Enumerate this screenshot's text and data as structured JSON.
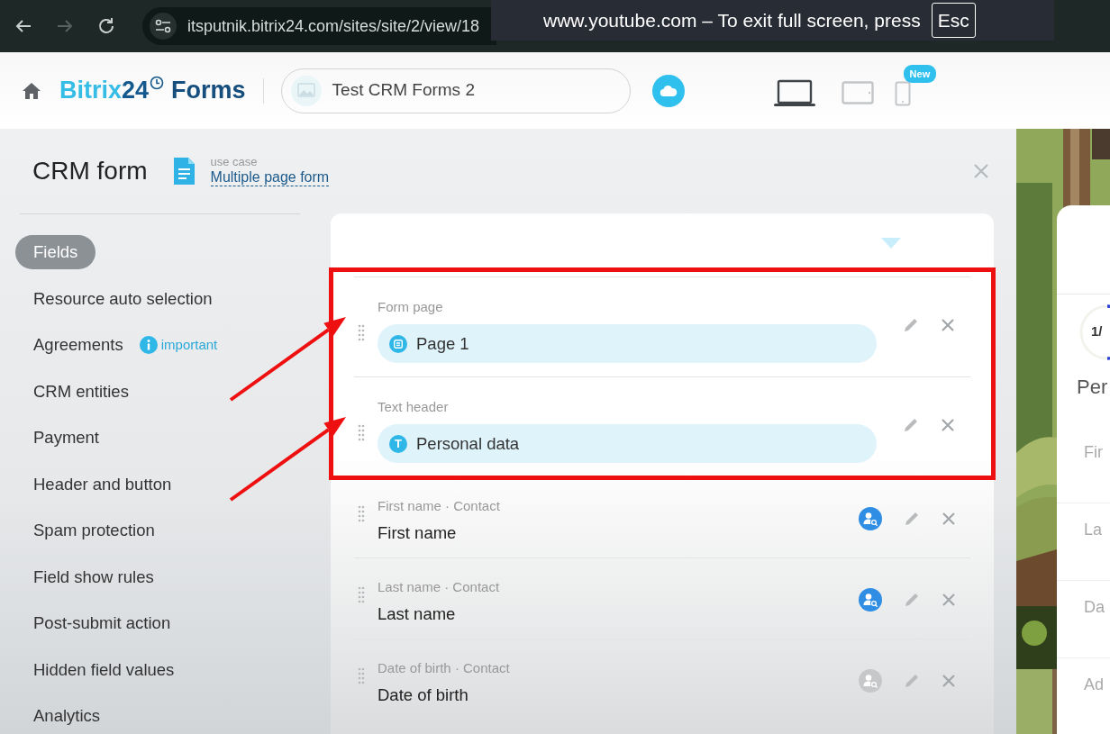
{
  "browser": {
    "nav": [
      {
        "kind": "back",
        "disabled": false
      },
      {
        "kind": "forward",
        "disabled": true
      },
      {
        "kind": "reload",
        "disabled": false
      }
    ],
    "url": "itsputnik.bitrix24.com/sites/site/2/view/18"
  },
  "fullscreen_notice": {
    "text": "www.youtube.com – To exit full screen, press",
    "key": "Esc"
  },
  "header": {
    "logo": {
      "brand": "Bitrix",
      "number": "24",
      "product": "Forms"
    },
    "site_name": "Test CRM Forms 2",
    "devices": [
      {
        "kind": "laptop",
        "selected": true
      },
      {
        "kind": "tablet",
        "selected": false
      },
      {
        "kind": "phone",
        "selected": false,
        "badge": "New"
      }
    ]
  },
  "panel": {
    "title": "CRM form",
    "use_case_label": "use case",
    "use_case": "Multiple page form"
  },
  "menu": [
    {
      "label": "Fields",
      "selected": true
    },
    {
      "label": "Resource auto selection",
      "selected": false
    },
    {
      "label": "Agreements",
      "selected": false,
      "note": "important"
    },
    {
      "label": "CRM entities",
      "selected": false
    },
    {
      "label": "Payment",
      "selected": false
    },
    {
      "label": "Header and button",
      "selected": false
    },
    {
      "label": "Spam protection",
      "selected": false
    },
    {
      "label": "Field show rules",
      "selected": false
    },
    {
      "label": "Post-submit action",
      "selected": false
    },
    {
      "label": "Hidden field values",
      "selected": false
    },
    {
      "label": "Analytics",
      "selected": false
    }
  ],
  "fields": [
    {
      "kind": "page",
      "caption": "Form page",
      "value": "Page 1",
      "highlighted": true
    },
    {
      "kind": "header",
      "caption": "Text header",
      "value": "Personal data",
      "icon_text": "T",
      "highlighted": true
    },
    {
      "kind": "field",
      "caption": "First name · Contact",
      "value": "First name",
      "crm_active": true,
      "highlighted": false
    },
    {
      "kind": "field",
      "caption": "Last name · Contact",
      "value": "Last name",
      "crm_active": true,
      "highlighted": false
    },
    {
      "kind": "field",
      "caption": "Date of birth · Contact",
      "value": "Date of birth",
      "crm_active": false,
      "highlighted": false
    }
  ],
  "preview": {
    "progress": "1/",
    "heading": "Per",
    "labels": [
      "Fir",
      "La",
      "Da",
      "Ad"
    ]
  }
}
